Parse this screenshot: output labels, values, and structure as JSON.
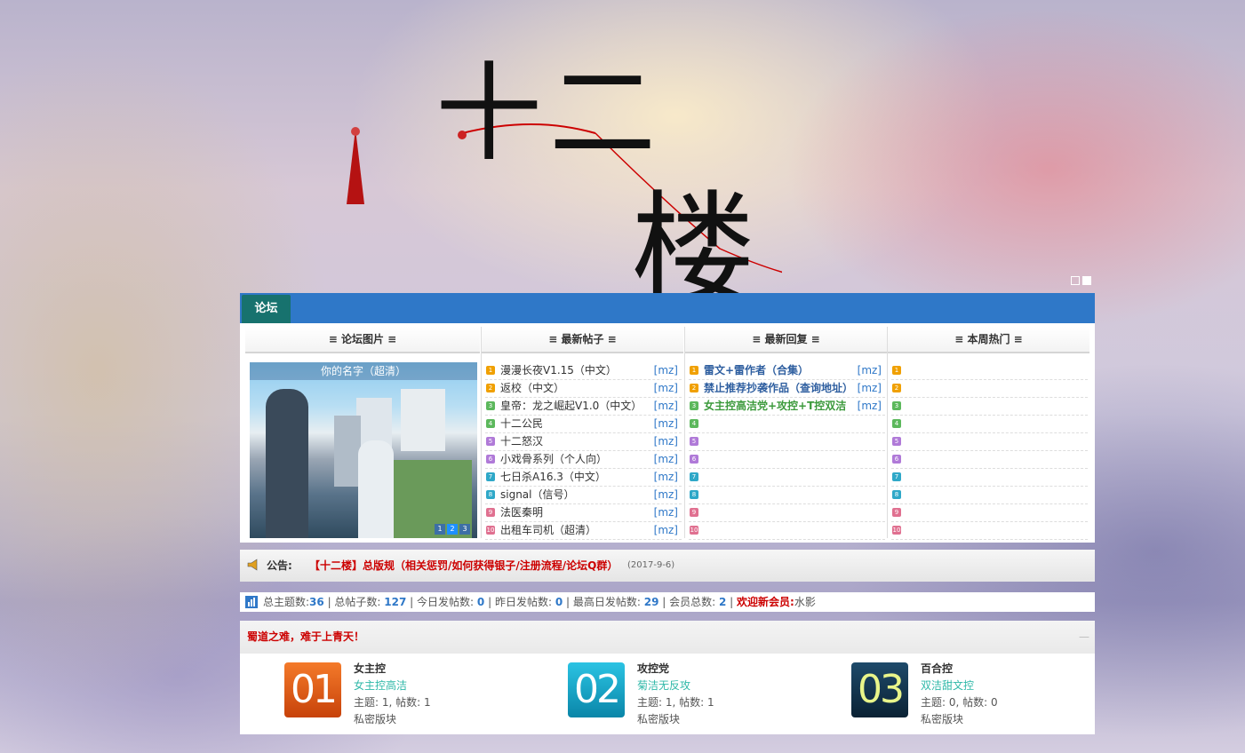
{
  "header": {
    "logo_text_1": "十二",
    "logo_text_2": "楼"
  },
  "tabbar": {
    "tab_label": "论坛"
  },
  "columns": {
    "pics": "≡ 论坛图片 ≡",
    "new_posts": "≡ 最新帖子 ≡",
    "new_replies": "≡ 最新回复 ≡",
    "hot": "≡ 本周热门 ≡"
  },
  "picture": {
    "caption": "你的名字（超清）",
    "dots": [
      "1",
      "2",
      "3"
    ]
  },
  "num_colors": [
    "#f0a000",
    "#f0a000",
    "#5cb85c",
    "#5cb85c",
    "#b07ad8",
    "#b07ad8",
    "#2fa8c8",
    "#2fa8c8",
    "#e07090",
    "#e07090"
  ],
  "new_posts": [
    {
      "n": "1",
      "title": "漫漫长夜V1.15（中文）",
      "tag": "[mz]"
    },
    {
      "n": "2",
      "title": "返校（中文）",
      "tag": "[mz]"
    },
    {
      "n": "3",
      "title": "皇帝：龙之崛起V1.0（中文）",
      "tag": "[mz]"
    },
    {
      "n": "4",
      "title": "十二公民",
      "tag": "[mz]"
    },
    {
      "n": "5",
      "title": "十二怒汉",
      "tag": "[mz]"
    },
    {
      "n": "6",
      "title": "小戏骨系列（个人向）",
      "tag": "[mz]"
    },
    {
      "n": "7",
      "title": "七日杀A16.3（中文）",
      "tag": "[mz]"
    },
    {
      "n": "8",
      "title": "signal（信号）",
      "tag": "[mz]"
    },
    {
      "n": "9",
      "title": "法医秦明",
      "tag": "[mz]"
    },
    {
      "n": "10",
      "title": "出租车司机（超清）",
      "tag": "[mz]"
    }
  ],
  "new_replies": [
    {
      "n": "1",
      "title": "雷文+雷作者（合集）",
      "tag": "[mz]",
      "color": "#2f5fa0"
    },
    {
      "n": "2",
      "title": "禁止推荐抄袭作品（查询地址）",
      "tag": "[mz]",
      "color": "#2f5fa0"
    },
    {
      "n": "3",
      "title": "女主控高洁党+攻控+T控双洁",
      "tag": "[mz]",
      "color": "#3c9a3c"
    },
    {
      "n": "4",
      "title": "",
      "tag": ""
    },
    {
      "n": "5",
      "title": "",
      "tag": ""
    },
    {
      "n": "6",
      "title": "",
      "tag": ""
    },
    {
      "n": "7",
      "title": "",
      "tag": ""
    },
    {
      "n": "8",
      "title": "",
      "tag": ""
    },
    {
      "n": "9",
      "title": "",
      "tag": ""
    },
    {
      "n": "10",
      "title": "",
      "tag": ""
    }
  ],
  "hot": [
    "1",
    "2",
    "3",
    "4",
    "5",
    "6",
    "7",
    "8",
    "9",
    "10"
  ],
  "notice": {
    "label": "公告:",
    "message": "【十二楼】总版规（相关惩罚/如何获得银子/注册流程/论坛Q群）",
    "date": "(2017-9-6)"
  },
  "stats": {
    "topics_label": "总主题数:",
    "topics": "36",
    "posts_label": "总帖子数:",
    "posts": "127",
    "today_label": "今日发帖数:",
    "today": "0",
    "yesterday_label": "昨日发帖数:",
    "yesterday": "0",
    "max_label": "最高日发帖数:",
    "max": "29",
    "members_label": "会员总数:",
    "members": "2",
    "welcome_label": "欢迎新会员:",
    "welcome": "水影"
  },
  "group": {
    "title": "蜀道之难，难于上青天！",
    "collapse": "—",
    "forums": [
      {
        "badge": "01",
        "name": "女主控",
        "sub": "女主控高洁",
        "counts": "主题: 1, 帖数: 1",
        "note": "私密版块"
      },
      {
        "badge": "02",
        "name": "攻控党",
        "sub": "菊洁无反攻",
        "counts": "主题: 1, 帖数: 1",
        "note": "私密版块"
      },
      {
        "badge": "03",
        "name": "百合控",
        "sub": "双洁甜文控",
        "counts": "主题: 0, 帖数: 0",
        "note": "私密版块"
      }
    ]
  }
}
